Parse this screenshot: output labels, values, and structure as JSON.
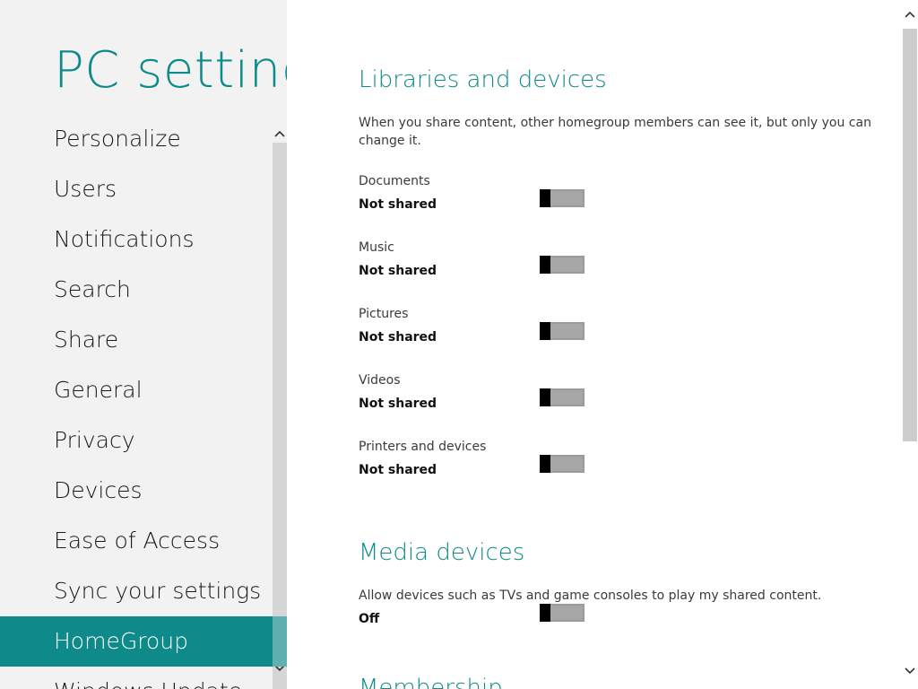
{
  "app": {
    "title": "PC settings"
  },
  "nav": {
    "items": [
      {
        "label": "Personalize"
      },
      {
        "label": "Users"
      },
      {
        "label": "Notifications"
      },
      {
        "label": "Search"
      },
      {
        "label": "Share"
      },
      {
        "label": "General"
      },
      {
        "label": "Privacy"
      },
      {
        "label": "Devices"
      },
      {
        "label": "Ease of Access"
      },
      {
        "label": "Sync your settings"
      },
      {
        "label": "HomeGroup"
      },
      {
        "label": "Windows Update"
      }
    ],
    "selected": "HomeGroup"
  },
  "libraries": {
    "title": "Libraries and devices",
    "description": "When you share content, other homegroup members can see it, but only you can change it.",
    "settings": [
      {
        "label": "Documents",
        "state": "Not shared",
        "on": false
      },
      {
        "label": "Music",
        "state": "Not shared",
        "on": false
      },
      {
        "label": "Pictures",
        "state": "Not shared",
        "on": false
      },
      {
        "label": "Videos",
        "state": "Not shared",
        "on": false
      },
      {
        "label": "Printers and devices",
        "state": "Not shared",
        "on": false
      }
    ]
  },
  "media": {
    "title": "Media devices",
    "description": "Allow devices such as TVs and game consoles to play my shared content.",
    "setting": {
      "state": "Off",
      "on": false
    }
  },
  "next_section": {
    "title": "Membership"
  },
  "colors": {
    "accent": "#0e8a8a",
    "left_bg": "#f2f2f2",
    "toggle_off": "#a6a6a6"
  },
  "icons": {
    "scroll_up": "chevron-up-icon",
    "scroll_down": "chevron-down-icon"
  }
}
